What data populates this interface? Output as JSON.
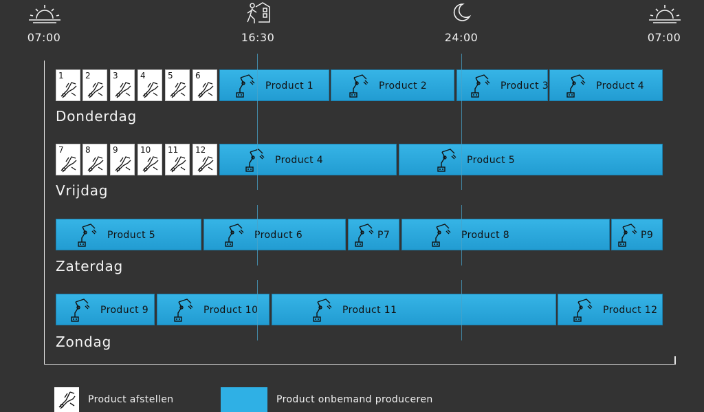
{
  "timeline": {
    "times": [
      "07:00",
      "16:30",
      "24:00",
      "07:00"
    ],
    "icons": [
      "sunrise-icon",
      "worker-leaving-icon",
      "moon-icon",
      "sunrise-icon"
    ]
  },
  "days": [
    {
      "name": "Donderdag",
      "setups": [
        "1",
        "2",
        "3",
        "4",
        "5",
        "6"
      ],
      "products": [
        "Product 1",
        "Product 2",
        "Product 3",
        "Product 4"
      ]
    },
    {
      "name": "Vrijdag",
      "setups": [
        "7",
        "8",
        "9",
        "10",
        "11",
        "12"
      ],
      "products": [
        "Product 4",
        "Product 5"
      ]
    },
    {
      "name": "Zaterdag",
      "setups": [],
      "products": [
        "Product 5",
        "Product 6",
        "P7",
        "Product 8",
        "P9"
      ]
    },
    {
      "name": "Zondag",
      "setups": [],
      "products": [
        "Product 9",
        "Product 10",
        "Product 11",
        "Product 12"
      ]
    }
  ],
  "legend": {
    "setup_label": "Product afstellen",
    "production_label": "Product onbemand produceren"
  },
  "colors": {
    "background": "#333333",
    "production_blue": "#2fb0e5",
    "setup_white": "#ffffff"
  }
}
